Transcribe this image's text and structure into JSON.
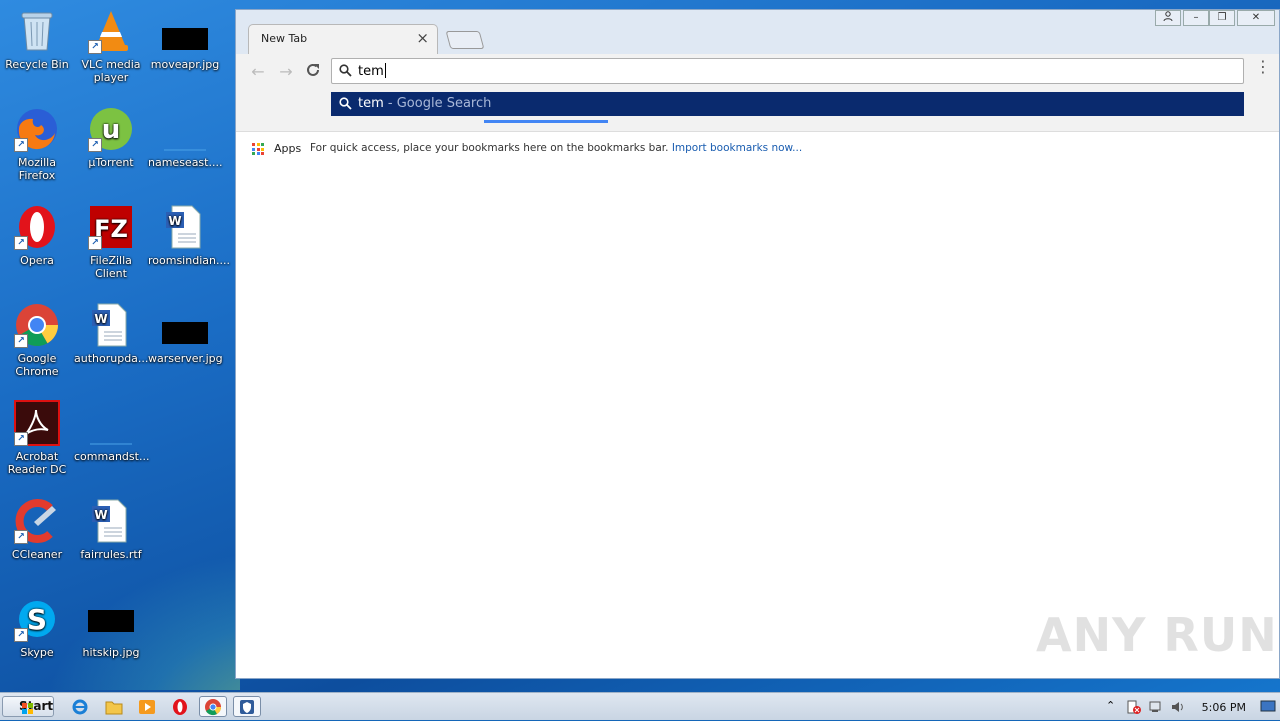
{
  "desktop": {
    "icons": [
      {
        "label": "Recycle Bin"
      },
      {
        "label": "VLC media player"
      },
      {
        "label": "moveapr.jpg"
      },
      {
        "label": "Mozilla Firefox"
      },
      {
        "label": "µTorrent"
      },
      {
        "label": "nameseast...."
      },
      {
        "label": "Opera"
      },
      {
        "label": "FileZilla Client"
      },
      {
        "label": "roomsindian...."
      },
      {
        "label": "Google Chrome"
      },
      {
        "label": "authorupda..."
      },
      {
        "label": "warserver.jpg"
      },
      {
        "label": "Acrobat Reader DC"
      },
      {
        "label": "commandst..."
      },
      {
        "label": "CCleaner"
      },
      {
        "label": "fairrules.rtf"
      },
      {
        "label": "Skype"
      },
      {
        "label": "hitskip.jpg"
      }
    ]
  },
  "browser": {
    "tab_title": "New Tab",
    "omnibox_value": "tem",
    "suggestion": {
      "query": "tem",
      "rest": " - Google Search"
    },
    "bookmarks": {
      "apps_label": "Apps",
      "hint": "For quick access, place your bookmarks here on the bookmarks bar.",
      "import_link": "Import bookmarks now..."
    }
  },
  "watermark": "ANY RUN",
  "taskbar": {
    "start_label": "Start",
    "clock": "5:06 PM"
  },
  "colors": {
    "suggestion_bg": "#0a2a6e",
    "accent": "#4285f4",
    "link": "#1a5db0"
  }
}
